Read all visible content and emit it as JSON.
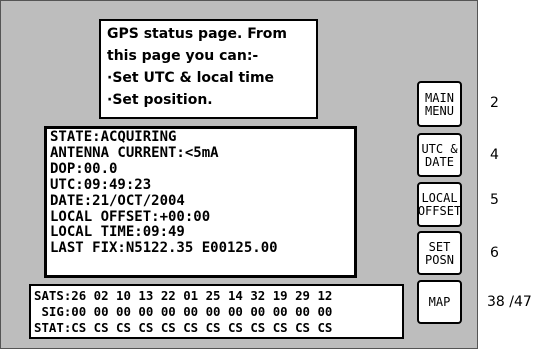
{
  "info": {
    "lines": [
      "GPS status page. From",
      "this page you can:-",
      "·Set UTC & local time",
      "·Set position."
    ]
  },
  "status": {
    "state": "STATE:ACQUIRING",
    "antenna_current": "ANTENNA CURRENT:<5mA",
    "dop": "DOP:00.0",
    "utc": "UTC:09:49:23",
    "date": "DATE:21/OCT/2004",
    "local_offset": "LOCAL OFFSET:+00:00",
    "local_time": "LOCAL TIME:09:49",
    "last_fix": "LAST FIX:N5122.35 E00125.00"
  },
  "satellites": {
    "sats": "SATS:26 02 10 13 22 01 25 14 32 19 29 12",
    "sig": " SIG:00 00 00 00 00 00 00 00 00 00 00 00",
    "stat": "STAT:CS CS CS CS CS CS CS CS CS CS CS CS"
  },
  "buttons": {
    "main_menu": [
      "MAIN",
      "MENU"
    ],
    "utc_date": [
      "UTC &",
      "DATE"
    ],
    "local_offset": [
      "LOCAL",
      "OFFSET"
    ],
    "set_posn": [
      "SET",
      "POSN"
    ],
    "map": [
      "MAP"
    ]
  },
  "side_numbers": {
    "main_menu": "2",
    "utc_date": "4",
    "local_offset": "5",
    "set_posn": "6",
    "map": "38 /47"
  },
  "colors": {
    "screen_background": "#bdbdbd",
    "panel_background": "#ffffff",
    "text": "#000000"
  }
}
